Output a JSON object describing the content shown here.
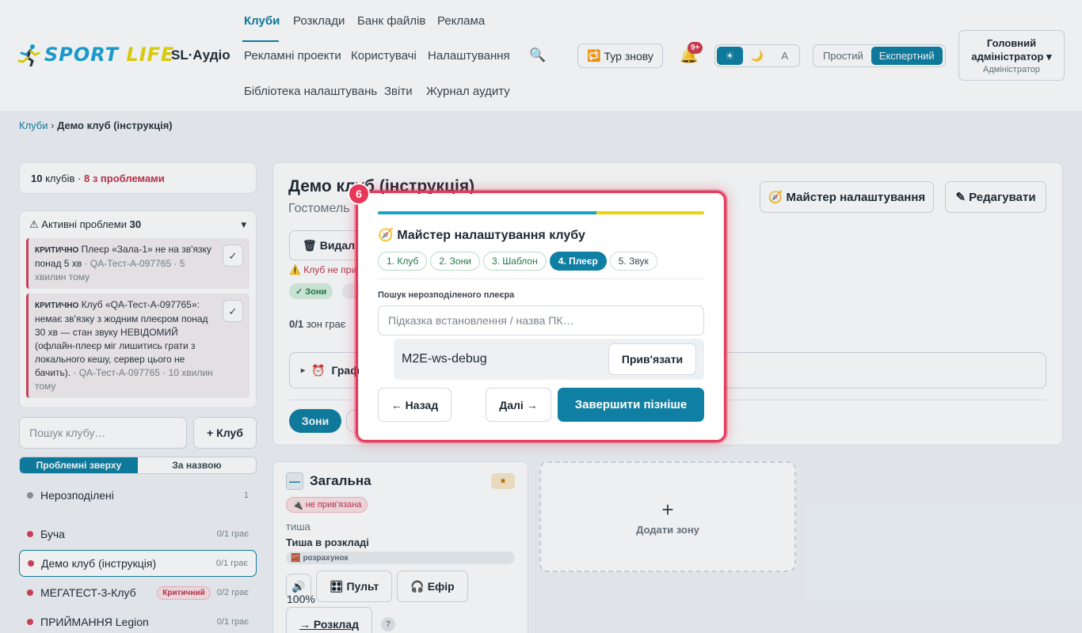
{
  "app": {
    "logo_part1": "SPORT",
    "logo_part2": "LIFE",
    "name": "SL·Аудіо"
  },
  "nav": {
    "row1": [
      "Клуби",
      "Розклади",
      "Банк файлів",
      "Реклама"
    ],
    "row2": [
      "Рекламні проекти",
      "Користувачі",
      "Налаштування"
    ],
    "row3": [
      "Бібліотека налаштувань",
      "Звіти",
      "Журнал аудиту"
    ],
    "active": "Клуби"
  },
  "header": {
    "search_icon": "search-icon",
    "tour_label": "Тур знову",
    "notifications_count": "9+",
    "theme": {
      "light": "☀",
      "dark": "🌙",
      "auto": "A",
      "active": "light"
    },
    "modes": [
      "Простий",
      "Експертний"
    ],
    "active_mode": "Експертний",
    "user": {
      "name": "Головний адміністратор",
      "role": "Адміністратор"
    }
  },
  "breadcrumb": {
    "parent": "Клуби",
    "separator": "›",
    "current": "Демо клуб (інструкція)"
  },
  "sidebar": {
    "club_count": "10",
    "club_word": "клубів",
    "separator": "·",
    "problems_label": "8 з проблемами",
    "issues": {
      "title": "Активні проблеми",
      "count": "30",
      "items": [
        {
          "severity": "КРИТИЧНО",
          "text": "Плеєр «Зала-1» не на зв'язку понад 5 хв",
          "meta": "· QA-Тест-А-097765 · 5 хвилин тому"
        },
        {
          "severity": "КРИТИЧНО",
          "text": "Клуб «QA-Тест-А-097765»: немає зв'язку з жодним плеєром понад 30 хв — стан звуку НЕВІДОМИЙ (офлайн-плеєр міг лишитись грати з локального кешу, сервер цього не бачить).",
          "meta": "· QA-Тест-А-097765 · 10 хвилин тому"
        }
      ]
    },
    "search_placeholder": "Пошук клубу…",
    "add_club_label": "+ Клуб",
    "sort_options": [
      "Проблемні зверху",
      "За назвою"
    ],
    "active_sort": "Проблемні зверху",
    "clubs": [
      {
        "name": "Нерозподілені",
        "stat": "1",
        "status": "gray"
      },
      {
        "name": "Буча",
        "stat": "0/1 грає",
        "status": "red"
      },
      {
        "name": "Демо клуб (інструкція)",
        "stat": "0/1 грає",
        "status": "red",
        "active": true
      },
      {
        "name": "МЕГАТЕСТ-3-Клуб",
        "badge": "Критичний",
        "stat": "0/2 грає",
        "status": "red"
      },
      {
        "name": "ПРИЙМАННЯ Legion",
        "stat": "0/1 грає",
        "status": "red"
      }
    ],
    "colors": {
      "red": "#d6405a",
      "gray": "#8a949e"
    }
  },
  "main": {
    "title": "Демо клуб (інструкція)",
    "subtitle": "Гостомель",
    "delete_label": "Видал",
    "warning": "Клуб не при",
    "zone_pill": "✓ Зони",
    "playing_count": "0/1",
    "playing_label": "зон грає",
    "schedule_label": "Граф",
    "tab_zones": "Зони",
    "wizard_label": "Майстер налаштування",
    "edit_label": "✎ Редагувати"
  },
  "zone": {
    "title": "Загальна",
    "unbound": "не прив'язана",
    "silence": "тиша",
    "silence_sub": "Тиша в розкладі",
    "calc": "розрахунок",
    "volume": "100%",
    "pult": "Пульт",
    "efir": "Ефір",
    "schedule_link": "→ Розклад",
    "help": "?"
  },
  "add_zone": {
    "plus": "+",
    "label": "Додати зону"
  },
  "wizard": {
    "step_number": "6",
    "progress": 0.67,
    "title": "Майстер налаштування клубу",
    "steps": [
      {
        "label": "1. Клуб",
        "state": "done"
      },
      {
        "label": "2. Зони",
        "state": "done"
      },
      {
        "label": "3. Шаблон",
        "state": "done"
      },
      {
        "label": "4. Плеєр",
        "state": "current"
      },
      {
        "label": "5. Звук",
        "state": "todo"
      }
    ],
    "search_label": "Пошук нерозподіленого плеєра",
    "search_placeholder": "Підказка встановлення / назва ПК…",
    "player_name": "M2E-ws-debug",
    "bind_label": "Прив'язати",
    "back_label": "← Назад",
    "next_label": "Далі →",
    "finish_label": "Завершити пізніше",
    "colors": {
      "accent": "#0f7fa3",
      "highlight": "#e8385a"
    }
  }
}
